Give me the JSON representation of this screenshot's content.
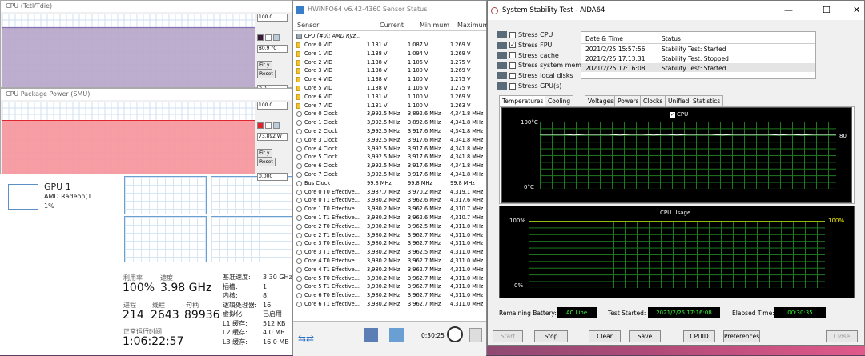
{
  "task_manager": {
    "gpu": {
      "name": "GPU 1",
      "model": "AMD Radeon(T...",
      "pct": "1%"
    },
    "labels": {
      "utilization": "利用率",
      "speed": "速度",
      "processes": "进程",
      "threads": "线程",
      "handles": "句柄",
      "uptime": "正常运行时间"
    },
    "values": {
      "utilization": "100%",
      "speed": "3.98 GHz",
      "processes": "214",
      "threads": "2643",
      "handles": "89936",
      "uptime": "1:06:22:57"
    },
    "specs": [
      {
        "k": "基准速度:",
        "v": "3.30 GHz"
      },
      {
        "k": "插槽:",
        "v": "1"
      },
      {
        "k": "内核:",
        "v": "8"
      },
      {
        "k": "逻辑处理器:",
        "v": "16"
      },
      {
        "k": "虚拟化:",
        "v": "已启用"
      },
      {
        "k": "L1 缓存:",
        "v": "512 KB"
      },
      {
        "k": "L2 缓存:",
        "v": "4.0 MB"
      },
      {
        "k": "L3 缓存:",
        "v": "16.0 MB"
      }
    ]
  },
  "graph1": {
    "title": "CPU (Tctl/Tdie)",
    "max": "100.0",
    "value": "80.9 °C",
    "min": "0.0",
    "fit": "Fit y",
    "reset": "Reset",
    "color": "#7b5ea6",
    "fill": "#b7a5c9"
  },
  "graph2": {
    "title": "CPU Package Power (SMU)",
    "max": "100.0",
    "value": "73.892 W",
    "min": "0.000",
    "fit": "Fit y",
    "reset": "Reset",
    "color": "#e0242c",
    "fill": "#f6949a"
  },
  "hwinfo": {
    "title": "HWiNFO64 v6.42-4360 Sensor Status",
    "columns": [
      "Sensor",
      "Current",
      "Minimum",
      "Maximum"
    ],
    "group": "CPU [#0]: AMD Ryz...",
    "rows": [
      [
        "v",
        "Core 0 VID",
        "1.131 V",
        "1.087 V",
        "1.269 V"
      ],
      [
        "v",
        "Core 1 VID",
        "1.138 V",
        "1.094 V",
        "1.269 V"
      ],
      [
        "v",
        "Core 2 VID",
        "1.138 V",
        "1.106 V",
        "1.275 V"
      ],
      [
        "v",
        "Core 3 VID",
        "1.138 V",
        "1.100 V",
        "1.269 V"
      ],
      [
        "v",
        "Core 4 VID",
        "1.138 V",
        "1.100 V",
        "1.275 V"
      ],
      [
        "v",
        "Core 5 VID",
        "1.138 V",
        "1.106 V",
        "1.275 V"
      ],
      [
        "v",
        "Core 6 VID",
        "1.131 V",
        "1.100 V",
        "1.269 V"
      ],
      [
        "v",
        "Core 7 VID",
        "1.131 V",
        "1.100 V",
        "1.263 V"
      ],
      [
        "c",
        "Core 0 Clock",
        "3,992.5 MHz",
        "3,892.6 MHz",
        "4,341.8 MHz"
      ],
      [
        "c",
        "Core 1 Clock",
        "3,992.5 MHz",
        "3,892.6 MHz",
        "4,341.8 MHz"
      ],
      [
        "c",
        "Core 2 Clock",
        "3,992.5 MHz",
        "3,917.6 MHz",
        "4,341.8 MHz"
      ],
      [
        "c",
        "Core 3 Clock",
        "3,992.5 MHz",
        "3,917.6 MHz",
        "4,341.8 MHz"
      ],
      [
        "c",
        "Core 4 Clock",
        "3,992.5 MHz",
        "3,917.6 MHz",
        "4,341.8 MHz"
      ],
      [
        "c",
        "Core 5 Clock",
        "3,992.5 MHz",
        "3,917.6 MHz",
        "4,341.8 MHz"
      ],
      [
        "c",
        "Core 6 Clock",
        "3,992.5 MHz",
        "3,917.6 MHz",
        "4,341.8 MHz"
      ],
      [
        "c",
        "Core 7 Clock",
        "3,992.5 MHz",
        "3,917.6 MHz",
        "4,341.8 MHz"
      ],
      [
        "c",
        "Bus Clock",
        "99.8 MHz",
        "99.8 MHz",
        "99.8 MHz"
      ],
      [
        "c",
        "Core 0 T0 Effective...",
        "3,987.7 MHz",
        "3,970.2 MHz",
        "4,319.1 MHz"
      ],
      [
        "c",
        "Core 0 T1 Effective...",
        "3,980.2 MHz",
        "3,962.6 MHz",
        "4,317.6 MHz"
      ],
      [
        "c",
        "Core 1 T0 Effective...",
        "3,980.2 MHz",
        "3,962.6 MHz",
        "4,310.7 MHz"
      ],
      [
        "c",
        "Core 1 T1 Effective...",
        "3,980.2 MHz",
        "3,962.6 MHz",
        "4,310.7 MHz"
      ],
      [
        "c",
        "Core 2 T0 Effective...",
        "3,980.2 MHz",
        "3,962.5 MHz",
        "4,311.0 MHz"
      ],
      [
        "c",
        "Core 2 T1 Effective...",
        "3,980.2 MHz",
        "3,962.7 MHz",
        "4,311.0 MHz"
      ],
      [
        "c",
        "Core 3 T0 Effective...",
        "3,980.2 MHz",
        "3,962.7 MHz",
        "4,311.0 MHz"
      ],
      [
        "c",
        "Core 3 T1 Effective...",
        "3,980.2 MHz",
        "3,962.5 MHz",
        "4,311.0 MHz"
      ],
      [
        "c",
        "Core 4 T0 Effective...",
        "3,980.2 MHz",
        "3,962.7 MHz",
        "4,311.0 MHz"
      ],
      [
        "c",
        "Core 4 T1 Effective...",
        "3,980.2 MHz",
        "3,962.7 MHz",
        "4,311.0 MHz"
      ],
      [
        "c",
        "Core 5 T0 Effective...",
        "3,980.2 MHz",
        "3,962.7 MHz",
        "4,311.0 MHz"
      ],
      [
        "c",
        "Core 5 T1 Effective...",
        "3,980.2 MHz",
        "3,962.7 MHz",
        "4,311.0 MHz"
      ],
      [
        "c",
        "Core 6 T0 Effective...",
        "3,980.2 MHz",
        "3,962.7 MHz",
        "4,311.0 MHz"
      ],
      [
        "c",
        "Core 6 T1 Effective...",
        "3,980.2 MHz",
        "3,962.7 MHz",
        "4,311.0 MHz"
      ]
    ],
    "timer": "0:30:25"
  },
  "aida": {
    "title": "System Stability Test - AIDA64",
    "stress": [
      {
        "label": "Stress CPU",
        "checked": false
      },
      {
        "label": "Stress FPU",
        "checked": true
      },
      {
        "label": "Stress cache",
        "checked": false
      },
      {
        "label": "Stress system memory",
        "checked": false
      },
      {
        "label": "Stress local disks",
        "checked": false
      },
      {
        "label": "Stress GPU(s)",
        "checked": false
      }
    ],
    "status_headers": [
      "Date & Time",
      "Status"
    ],
    "status_rows": [
      [
        "2021/2/25 15:57:56",
        "Stability Test: Started"
      ],
      [
        "2021/2/25 17:13:31",
        "Stability Test: Stopped"
      ],
      [
        "2021/2/25 17:16:08",
        "Stability Test: Started"
      ]
    ],
    "tabs": [
      "Temperatures",
      "Cooling Fans",
      "Voltages",
      "Powers",
      "Clocks",
      "Unified",
      "Statistics"
    ],
    "temp_graph": {
      "legend": "CPU",
      "top": "100°C",
      "bottom": "0°C",
      "value": "80"
    },
    "usage_graph": {
      "title": "CPU Usage",
      "top": "100%",
      "bottom": "0%",
      "value": "100%"
    },
    "battery_label": "Remaining Battery:",
    "battery": "AC Line",
    "started_label": "Test Started:",
    "started": "2021/2/25 17:16:08",
    "elapsed_label": "Elapsed Time:",
    "elapsed": "00:30:35",
    "buttons": [
      "Start",
      "Stop",
      "Clear",
      "Save",
      "CPUID",
      "Preferences",
      "Close"
    ]
  },
  "chart_data": [
    {
      "type": "line",
      "title": "",
      "series": [
        {
          "name": "CPU",
          "values": [
            81,
            81,
            81,
            80,
            81,
            81,
            81,
            80,
            81,
            81,
            80,
            81,
            80,
            81,
            81,
            81,
            80,
            81,
            81,
            81,
            81,
            80,
            81,
            80,
            81,
            81,
            81
          ]
        }
      ],
      "ylim": [
        0,
        100
      ]
    },
    {
      "type": "line",
      "title": "CPU Usage",
      "series": [
        {
          "name": "CPU",
          "values": [
            100,
            100,
            100,
            100,
            100,
            100,
            100,
            100,
            100,
            100,
            100,
            100,
            100,
            100,
            100,
            100,
            100,
            100,
            100,
            100
          ]
        }
      ],
      "ylim": [
        0,
        100
      ]
    }
  ]
}
